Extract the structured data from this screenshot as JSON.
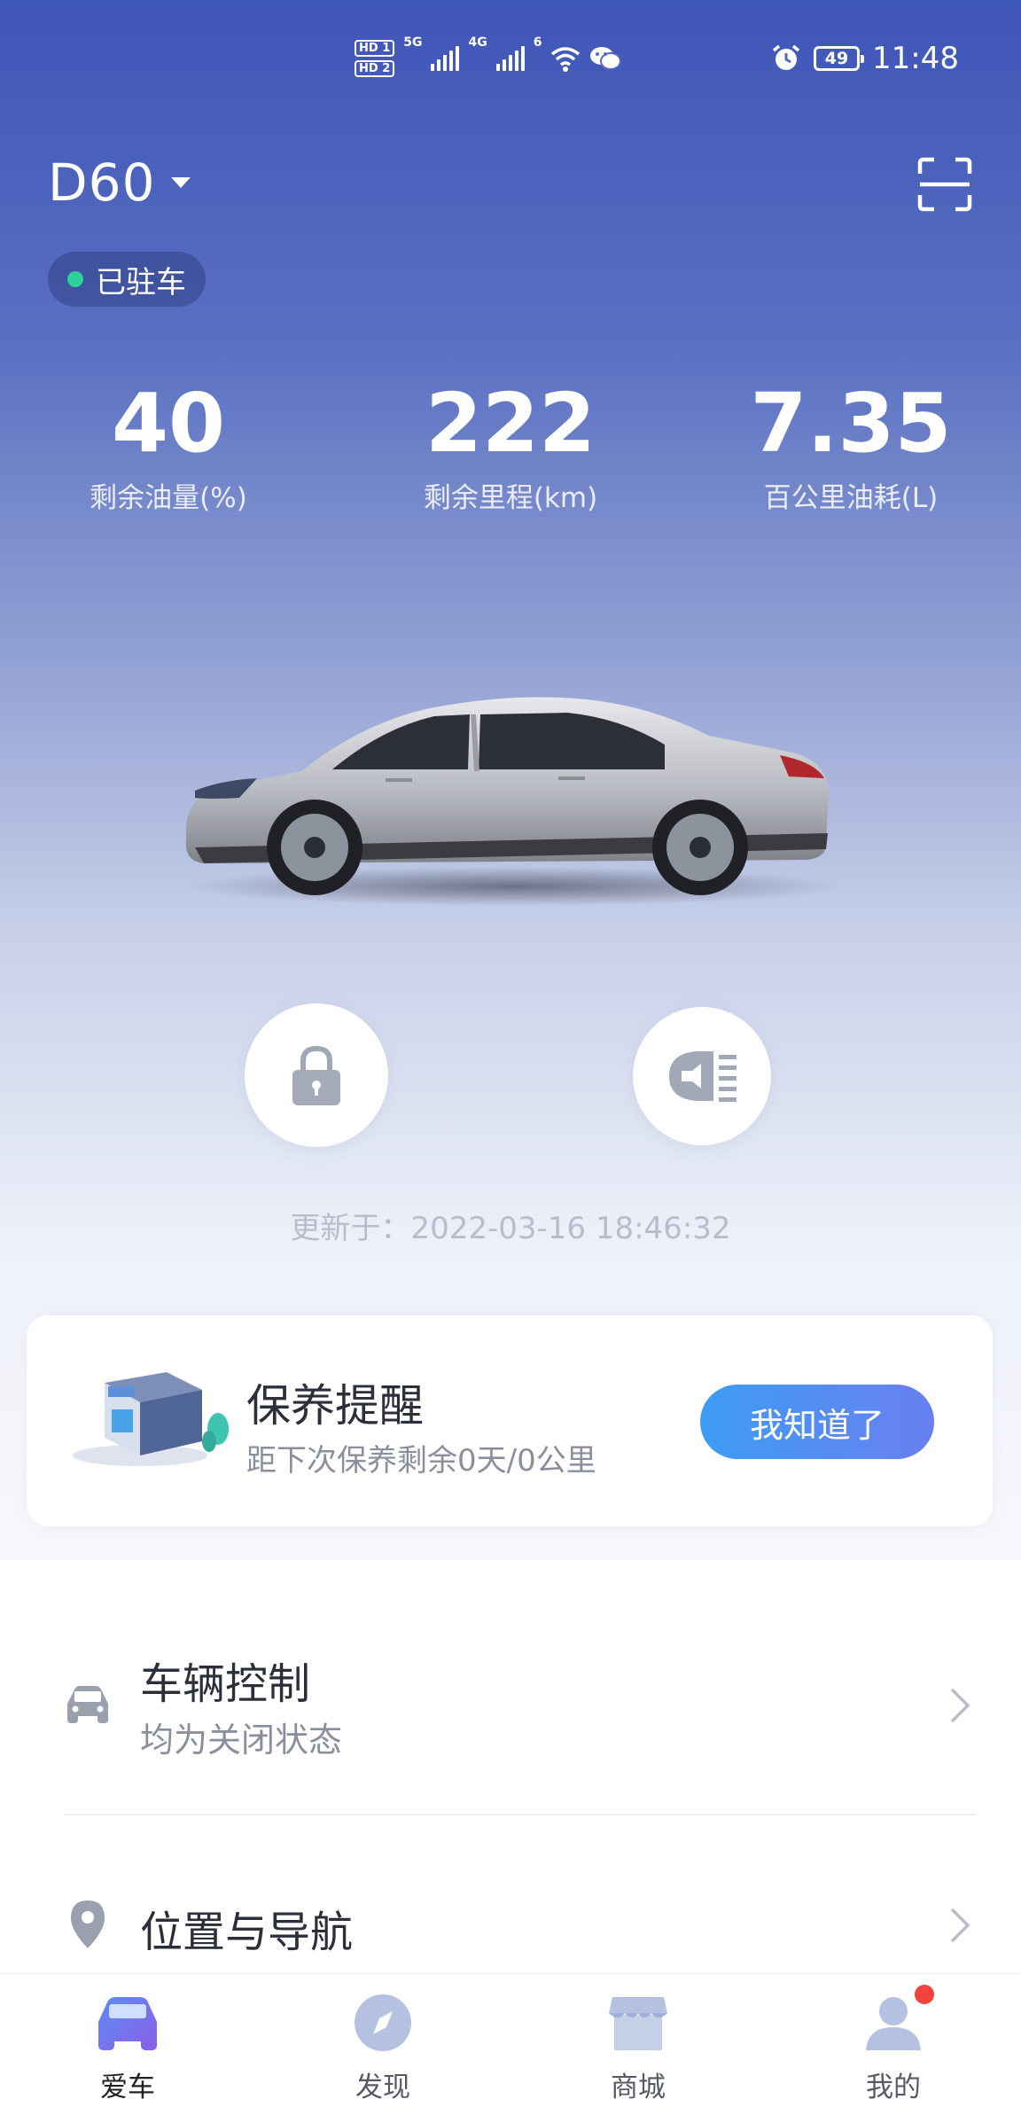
{
  "status_bar": {
    "hd1": "HD 1",
    "hd2": "HD 2",
    "net1": "5G",
    "net2": "4G",
    "wifi_label": "6",
    "battery": "49",
    "time": "11:48",
    "icons": [
      "signal-icon",
      "wifi-icon",
      "wechat-icon",
      "alarm-icon",
      "battery-icon"
    ]
  },
  "header": {
    "car_model": "D60",
    "parked_status": "已驻车"
  },
  "stats": [
    {
      "value": "40",
      "label": "剩余油量(%)"
    },
    {
      "value": "222",
      "label": "剩余里程(km)"
    },
    {
      "value": "7.35",
      "label": "百公里油耗(L)"
    }
  ],
  "controls": {
    "lock_icon": "lock-icon",
    "horn_icon": "horn-lights-icon"
  },
  "updated_text": "更新于：2022-03-16 18:46:32",
  "maintenance": {
    "title": "保养提醒",
    "subtitle": "距下次保养剩余0天/0公里",
    "button": "我知道了"
  },
  "menu": [
    {
      "title": "车辆控制",
      "subtitle": "均为关闭状态",
      "icon": "car-icon"
    },
    {
      "title": "位置与导航",
      "subtitle": "",
      "icon": "location-pin-icon"
    }
  ],
  "tabs": [
    {
      "label": "爱车",
      "icon": "car-tab-icon",
      "active": true
    },
    {
      "label": "发现",
      "icon": "compass-icon",
      "active": false
    },
    {
      "label": "商城",
      "icon": "store-icon",
      "active": false
    },
    {
      "label": "我的",
      "icon": "profile-icon",
      "active": false,
      "badge": true
    }
  ],
  "colors": {
    "hero_top": "#3e55b8",
    "accent": "#3d9cf5",
    "parked_dot": "#2fd19a",
    "badge": "#f2433c"
  }
}
